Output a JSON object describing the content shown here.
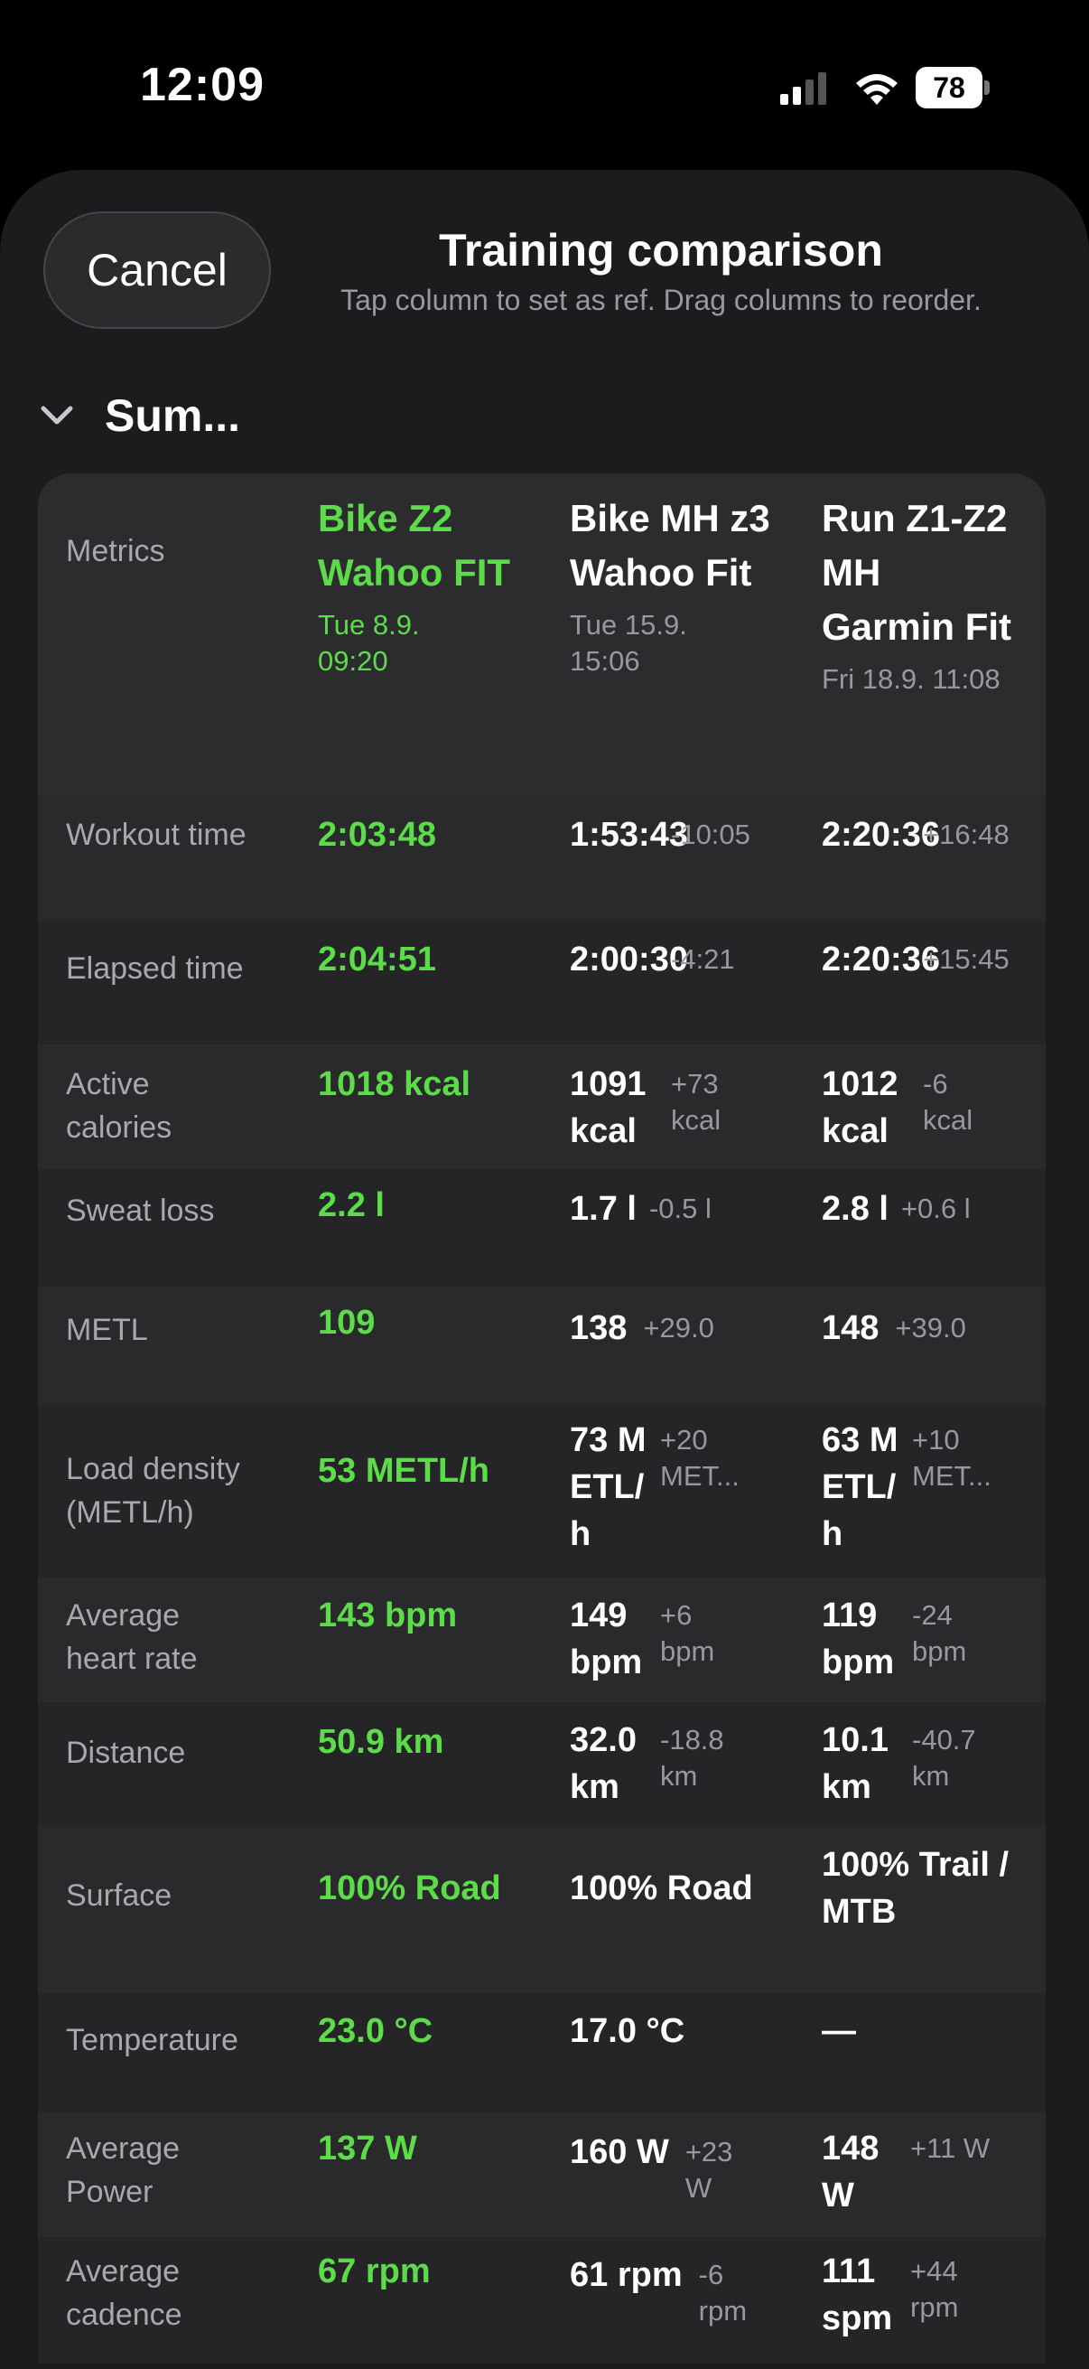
{
  "status": {
    "time": "12:09",
    "battery": "78"
  },
  "header": {
    "cancel_label": "Cancel",
    "title": "Training comparison",
    "subtitle": "Tap column to set as ref. Drag columns to reorder."
  },
  "section": {
    "title": "Sum..."
  },
  "table": {
    "metrics_label": "Metrics",
    "columns": [
      {
        "name": "Bike Z2 Wahoo FIT",
        "date": "Tue 8.9. 09:20"
      },
      {
        "name": "Bike MH z3 Wahoo Fit",
        "date": "Tue 15.9. 15:06"
      },
      {
        "name": "Run Z1-Z2 MH Garmin Fit",
        "date": "Fri 18.9. 11:08"
      }
    ],
    "rows": [
      {
        "label": "Workout time",
        "ref": "2:03:48",
        "v2": "1:53:43",
        "d2": "-10:05",
        "v3": "2:20:36",
        "d3": "+16:48"
      },
      {
        "label": "Elapsed time",
        "ref": "2:04:51",
        "v2": "2:00:30",
        "d2": "-4:21",
        "v3": "2:20:36",
        "d3": "+15:45"
      },
      {
        "label": "Active calories",
        "ref": "1018 kcal",
        "v2": "1091 kcal",
        "d2": "+73 kcal",
        "v3": "1012 kcal",
        "d3": "-6 kcal"
      },
      {
        "label": "Sweat loss",
        "ref": "2.2 l",
        "v2": "1.7 l",
        "d2": "-0.5 l",
        "v3": "2.8 l",
        "d3": "+0.6 l"
      },
      {
        "label": "METL",
        "ref": "109",
        "v2": "138",
        "d2": "+29.0",
        "v3": "148",
        "d3": "+39.0"
      },
      {
        "label": "Load density (METL/h)",
        "ref": "53 METL/h",
        "v2": "73 METL/h",
        "d2": "+20 MET...",
        "v3": "63 METL/h",
        "d3": "+10 MET..."
      },
      {
        "label": "Average heart rate",
        "ref": "143 bpm",
        "v2": "149 bpm",
        "d2": "+6 bpm",
        "v3": "119 bpm",
        "d3": "-24 bpm"
      },
      {
        "label": "Distance",
        "ref": "50.9 km",
        "v2": "32.0 km",
        "d2": "-18.8 km",
        "v3": "10.1 km",
        "d3": "-40.7 km"
      },
      {
        "label": "Surface",
        "ref": "100% Road",
        "v2": "100% Road",
        "d2": "",
        "v3": "100% Trail / MTB",
        "d3": ""
      },
      {
        "label": "Temperature",
        "ref": "23.0 °C",
        "v2": "17.0 °C",
        "d2": "",
        "v3": "—",
        "d3": ""
      },
      {
        "label": "Average Power",
        "ref": "137 W",
        "v2": "160 W",
        "d2": "+23 W",
        "v3": "148 W",
        "d3": "+11 W"
      },
      {
        "label": "Average cadence",
        "ref": "67 rpm",
        "v2": "61 rpm",
        "d2": "-6 rpm",
        "v3": "111 spm",
        "d3": "+44 rpm"
      }
    ]
  }
}
